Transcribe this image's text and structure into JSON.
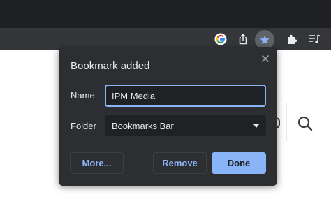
{
  "dialog": {
    "title": "Bookmark added",
    "name_label": "Name",
    "name_value": "IPM Media",
    "folder_label": "Folder",
    "folder_value": "Bookmarks Bar",
    "more_label": "More...",
    "remove_label": "Remove",
    "done_label": "Done"
  },
  "toolbar": {
    "icons": [
      "google-icon",
      "share-icon",
      "bookmark-star-icon",
      "extensions-icon",
      "reading-list-icon"
    ]
  },
  "colors": {
    "accent": "#8ab4f8",
    "dialog_bg": "#2d2e31",
    "toolbar_bg": "#35363a"
  }
}
